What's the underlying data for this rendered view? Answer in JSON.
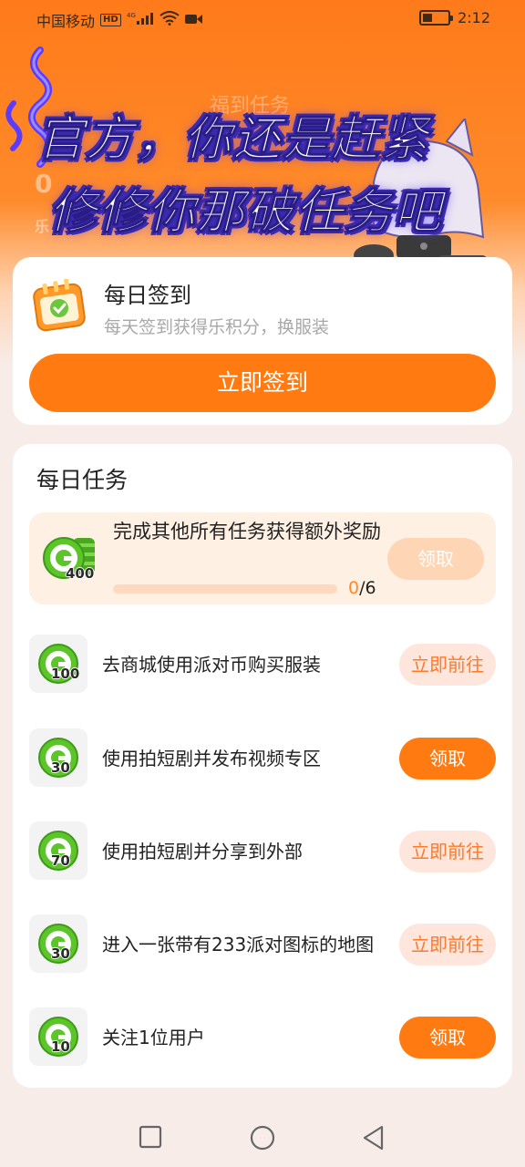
{
  "status_bar": {
    "carrier": "中国移动",
    "hd_badge": "HD",
    "network": "4G",
    "time": "2:12"
  },
  "header": {
    "background_title": "福到任务",
    "background_fragment_1": "0",
    "background_fragment_2": "乐",
    "overlay_line_1": "官方，你还是赶紧",
    "overlay_line_2": "修修你那破任务吧"
  },
  "signin": {
    "title": "每日签到",
    "subtitle": "每天签到获得乐积分，换服装",
    "button": "立即签到"
  },
  "daily_tasks": {
    "title": "每日任务",
    "bonus": {
      "text": "完成其他所有任务获得额外奖励",
      "reward": "400",
      "progress_current": "0",
      "progress_sep": "/",
      "progress_total": "6",
      "progress_fraction": 0,
      "button": "领取"
    },
    "items": [
      {
        "reward": "100",
        "text": "去商城使用派对币购买服装",
        "button": "立即前往",
        "state": "go"
      },
      {
        "reward": "30",
        "text": "使用拍短剧并发布视频专区",
        "button": "领取",
        "state": "claim"
      },
      {
        "reward": "70",
        "text": "使用拍短剧并分享到外部",
        "button": "立即前往",
        "state": "go"
      },
      {
        "reward": "30",
        "text": "进入一张带有233派对图标的地图",
        "button": "立即前往",
        "state": "go"
      },
      {
        "reward": "10",
        "text": "关注1位用户",
        "button": "领取",
        "state": "claim"
      }
    ]
  },
  "colors": {
    "accent": "#ff7b12",
    "coin_green": "#5cc52a",
    "go_button_bg": "#ffe6dc",
    "go_button_text": "#ff7a2a"
  },
  "icons": {
    "nav_square": "recent-apps-icon",
    "nav_circle": "home-icon",
    "nav_triangle": "back-icon"
  }
}
